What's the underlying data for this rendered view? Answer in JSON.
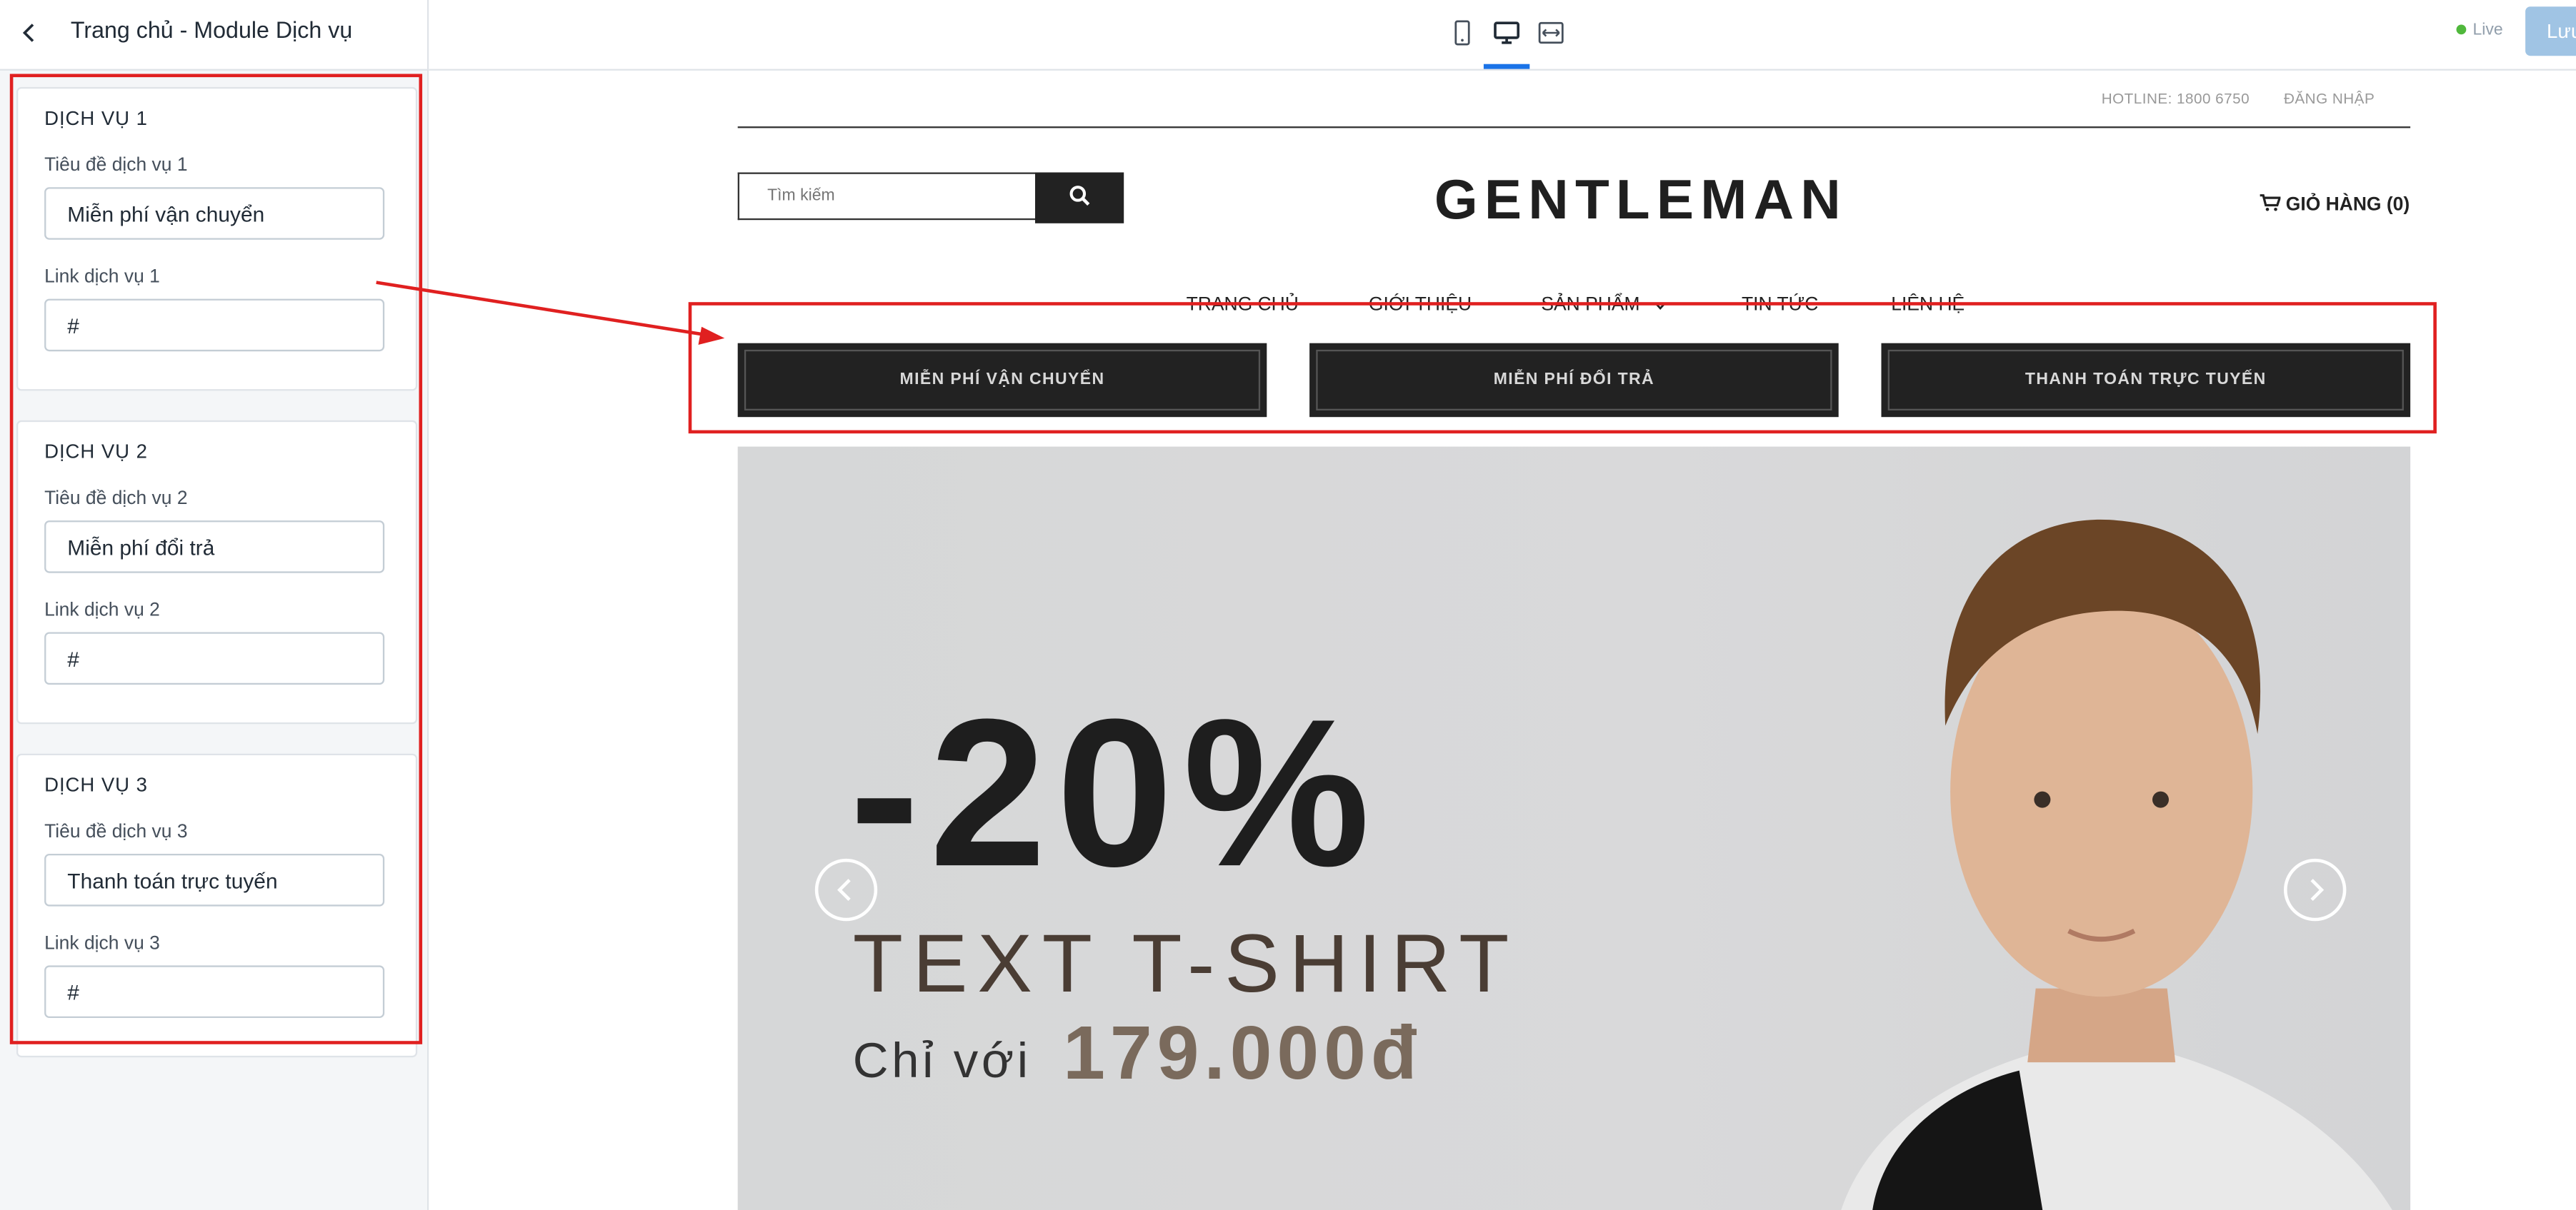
{
  "header": {
    "title": "Trang chủ - Module Dịch vụ"
  },
  "sidebar": {
    "services": [
      {
        "section": "DỊCH VỤ 1",
        "title_label": "Tiêu đề dịch vụ 1",
        "title_value": "Miễn phí vận chuyển",
        "link_label": "Link dịch vụ 1",
        "link_value": "#"
      },
      {
        "section": "DỊCH VỤ 2",
        "title_label": "Tiêu đề dịch vụ 2",
        "title_value": "Miễn phí đổi trả",
        "link_label": "Link dịch vụ 2",
        "link_value": "#"
      },
      {
        "section": "DỊCH VỤ 3",
        "title_label": "Tiêu đề dịch vụ 3",
        "title_value": "Thanh toán trực tuyến",
        "link_label": "Link dịch vụ 3",
        "link_value": "#"
      }
    ]
  },
  "toolbar": {
    "devices": [
      "mobile-icon",
      "desktop-icon",
      "fullwidth-icon"
    ],
    "active_device": "desktop-icon",
    "status": "Live",
    "save_label": "Lưu",
    "accent": "#1a73e8",
    "live_color": "#50b83c"
  },
  "preview": {
    "hotline": "HOTLINE: 1800 6750",
    "login": "ĐĂNG NHẬP",
    "search_placeholder": "Tìm kiếm",
    "logo": "GENTLEMAN",
    "cart": "GIỎ HÀNG (0)",
    "nav": [
      "TRANG CHỦ",
      "GIỚI THIỆU",
      "SẢN PHẨM",
      "TIN TỨC",
      "LIÊN HỆ"
    ],
    "services": [
      "MIỄN PHÍ VẬN CHUYỂN",
      "MIỄN PHÍ ĐỔI TRẢ",
      "THANH TOÁN TRỰC TUYẾN"
    ],
    "banner": {
      "discount": "-20%",
      "title": "TEXT T-SHIRT",
      "price_prefix": "Chỉ với",
      "price": "179.000đ"
    }
  },
  "annotation_color": "#e02020"
}
